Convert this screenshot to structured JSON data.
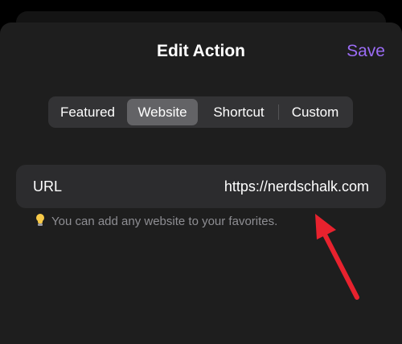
{
  "header": {
    "title": "Edit Action",
    "save_label": "Save"
  },
  "segments": {
    "items": [
      {
        "label": "Featured",
        "selected": false
      },
      {
        "label": "Website",
        "selected": true
      },
      {
        "label": "Shortcut",
        "selected": false
      },
      {
        "label": "Custom",
        "selected": false
      }
    ]
  },
  "url_row": {
    "label": "URL",
    "value": "https://nerdschalk.com"
  },
  "hint": {
    "icon": "lightbulb-icon",
    "text": "You can add any website to your favorites."
  },
  "annotation": {
    "icon": "red-arrow-icon",
    "color": "#e8222e"
  },
  "colors": {
    "accent": "#9b6cf5",
    "sheet_background": "#1e1e1e",
    "row_background": "#2c2c2e",
    "selected_segment": "#636366"
  }
}
